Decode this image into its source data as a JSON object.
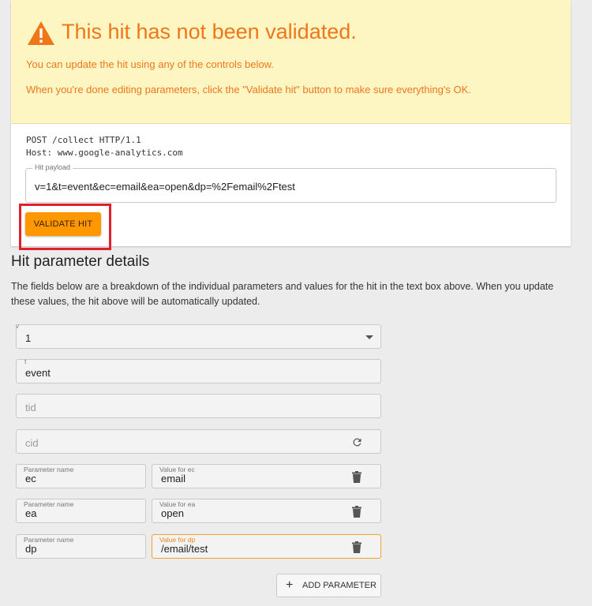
{
  "warning": {
    "title": "This hit has not been validated.",
    "line1": "You can update the hit using any of the controls below.",
    "line2": "When you're done editing parameters, click the \"Validate hit\" button to make sure everything's OK.",
    "icon": "warning-icon",
    "color": "#f0761a",
    "background": "#fdf6c3"
  },
  "request": {
    "line1": "POST /collect HTTP/1.1",
    "line2": "Host: www.google-analytics.com"
  },
  "payload": {
    "label": "Hit payload",
    "value": "v=1&t=event&ec=email&ea=open&dp=%2Femail%2Ftest"
  },
  "validate_button": {
    "label": "VALIDATE HIT",
    "color": "#ff9800"
  },
  "details": {
    "title": "Hit parameter details",
    "description": "The fields below are a breakdown of the individual parameters and values for the hit in the text box above. When you update these values, the hit above will be automatically updated."
  },
  "fields": {
    "v": {
      "label": "v",
      "value": "1"
    },
    "t": {
      "label": "t",
      "value": "event"
    },
    "tid": {
      "placeholder": "tid"
    },
    "cid": {
      "placeholder": "cid"
    }
  },
  "params": [
    {
      "name_label": "Parameter name",
      "name": "ec",
      "value_label": "Value for ec",
      "value": "email"
    },
    {
      "name_label": "Parameter name",
      "name": "ea",
      "value_label": "Value for ea",
      "value": "open"
    },
    {
      "name_label": "Parameter name",
      "name": "dp",
      "value_label": "Value for dp",
      "value": "/email/test"
    }
  ],
  "add_button": {
    "label": "ADD PARAMETER"
  }
}
